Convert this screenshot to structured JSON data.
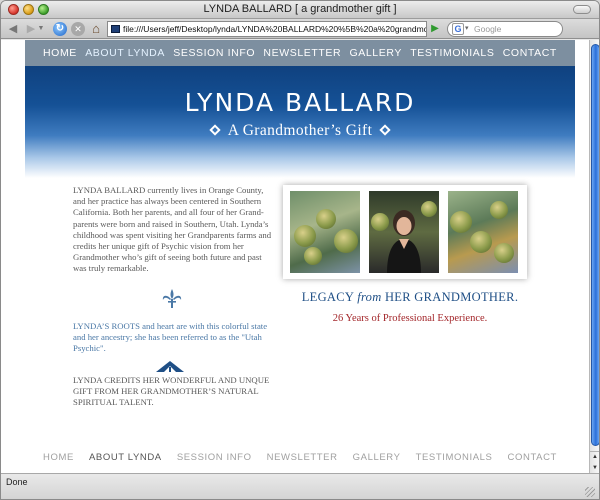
{
  "window": {
    "title": "LYNDA BALLARD [ a grandmother gift ]"
  },
  "toolbar": {
    "url": "file:///Users/jeff/Desktop/lynda/LYNDA%20BALLARD%20%5B%20a%20grandmc",
    "search_placeholder": "Google",
    "search_engine_letter": "G"
  },
  "nav": {
    "items": [
      "HOME",
      "ABOUT LYNDA",
      "SESSION INFO",
      "NEWSLETTER",
      "GALLERY",
      "TESTIMONIALS",
      "CONTACT"
    ],
    "active_index": 1
  },
  "header": {
    "brand": "LYNDA BALLARD",
    "tagline": "A Grandmother’s Gift"
  },
  "content": {
    "para1": "LYNDA BALLARD currently lives in Orange County, and her practice has always been centered in Southern California. Both her parents, and all four of her Grand-parents were born and raised in Southern, Utah. Lynda’s childhood was spent visiting her Grandparents farms and credits her unique gift of Psychic vision from her Grandmother who’s gift of seeing both future and past was truly remarkable.",
    "para2": "LYNDA’S ROOTS and heart are with this colorful state and her ancestry; she has been referred to as the \"Utah Psychic\".",
    "para3": "LYNDA CREDITS HER WONDERFUL AND UNQUE GIFT FROM HER GRANDMOTHER’S NATURAL SPIRITUAL TALENT.",
    "legacy_pre": "LEGACY ",
    "legacy_em": "from",
    "legacy_post": " HER GRANDMOTHER.",
    "years": "26 Years of Professional Experience."
  },
  "footer_nav": {
    "items": [
      "HOME",
      "ABOUT LYNDA",
      "SESSION INFO",
      "NEWSLETTER",
      "GALLERY",
      "TESTIMONIALS",
      "CONTACT"
    ]
  },
  "status": {
    "text": "Done"
  },
  "colors": {
    "nav_bg": "#7d8fa0",
    "header_top": "#0f417f",
    "legacy_blue": "#1f4f86",
    "years_red": "#a3262a",
    "roots_blue": "#4a78a6"
  }
}
